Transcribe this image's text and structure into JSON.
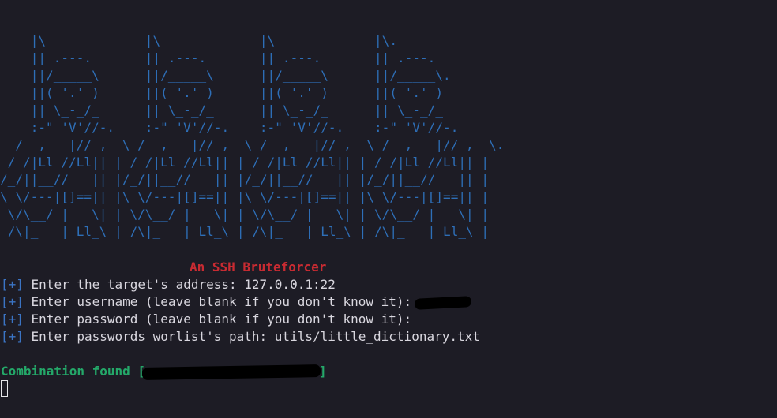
{
  "banner": {
    "ascii_art": "    |\\             |\\             |\\             |\\.\n    || .---.       || .---.       || .---.       || .---.\n    ||/_____\\      ||/_____\\      ||/_____\\      ||/_____\\.\n    ||( '.' )      ||( '.' )      ||( '.' )      ||( '.' )\n    || \\_-_/_      || \\_-_/_      || \\_-_/_      || \\_-_/_\n    :-\" 'V'//-.    :-\" 'V'//-.    :-\" 'V'//-.    :-\" 'V'//-.\n  /  ,   |// ,  \\ /  ,   |// ,  \\ /  ,   |// ,  \\ /  ,   |// ,  \\.\n / /|Ll //Ll|| | / /|Ll //Ll|| | / /|Ll //Ll|| | / /|Ll //Ll|| |\n/_/||__//   || |/_/||__//   || |/_/||__//   || |/_/||__//   || |\n\\ \\/---|[]==|| |\\ \\/---|[]==|| |\\ \\/---|[]==|| |\\ \\/---|[]==|| |\n \\/\\__/ |   \\| | \\/\\__/ |   \\| | \\/\\__/ |   \\| | \\/\\__/ |   \\| |\n /\\|_   | Ll_\\ | /\\|_   | Ll_\\ | /\\|_   | Ll_\\ | /\\|_   | Ll_\\ |",
    "title": "An SSH Bruteforcer"
  },
  "prompts": [
    {
      "prefix": "[+]",
      "text": " Enter the target's address: ",
      "value": "127.0.0.1:22"
    },
    {
      "prefix": "[+]",
      "text": " Enter username (leave blank if you don't know it): ",
      "value": ""
    },
    {
      "prefix": "[+]",
      "text": " Enter password (leave blank if you don't know it): ",
      "value": ""
    },
    {
      "prefix": "[+]",
      "text": " Enter passwords worlist's path: ",
      "value": "utils/little_dictionary.txt"
    }
  ],
  "result": {
    "label": "Combination found [",
    "close": "]"
  },
  "colors": {
    "background": "#1d1c25",
    "ascii": "#2e6fb8",
    "title": "#c92b32",
    "prefix": "#3b74c4",
    "text": "#d9d7df",
    "success": "#24a869"
  }
}
